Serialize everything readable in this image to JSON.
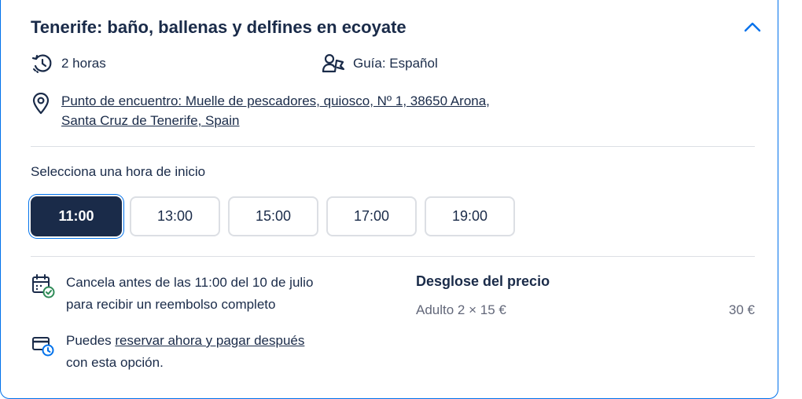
{
  "activity": {
    "title": "Tenerife: baño, ballenas y delfines en ecoyate",
    "duration": "2 horas",
    "guide": "Guía: Español",
    "meeting_point_line1": "Punto de encuentro: Muelle de pescadores, quiosco, Nº 1, 38650 Arona,",
    "meeting_point_line2": "Santa Cruz de Tenerife, Spain"
  },
  "start_time": {
    "label": "Selecciona una hora de inicio",
    "options": [
      "11:00",
      "13:00",
      "15:00",
      "17:00",
      "19:00"
    ],
    "selected": "11:00"
  },
  "cancellation": {
    "line1": "Cancela antes de las 11:00 del 10 de julio",
    "line2": "para recibir un reembolso completo"
  },
  "reserve_later": {
    "prefix": "Puedes ",
    "link": "reservar ahora y pagar después",
    "line2": "con esta opción."
  },
  "price": {
    "title": "Desglose del precio",
    "item": "Adulto 2 × 15 €",
    "total": "30 €"
  },
  "colors": {
    "accent": "#0071eb",
    "primary": "#1a2b49",
    "muted": "#63687a",
    "success": "#2e8b57"
  }
}
